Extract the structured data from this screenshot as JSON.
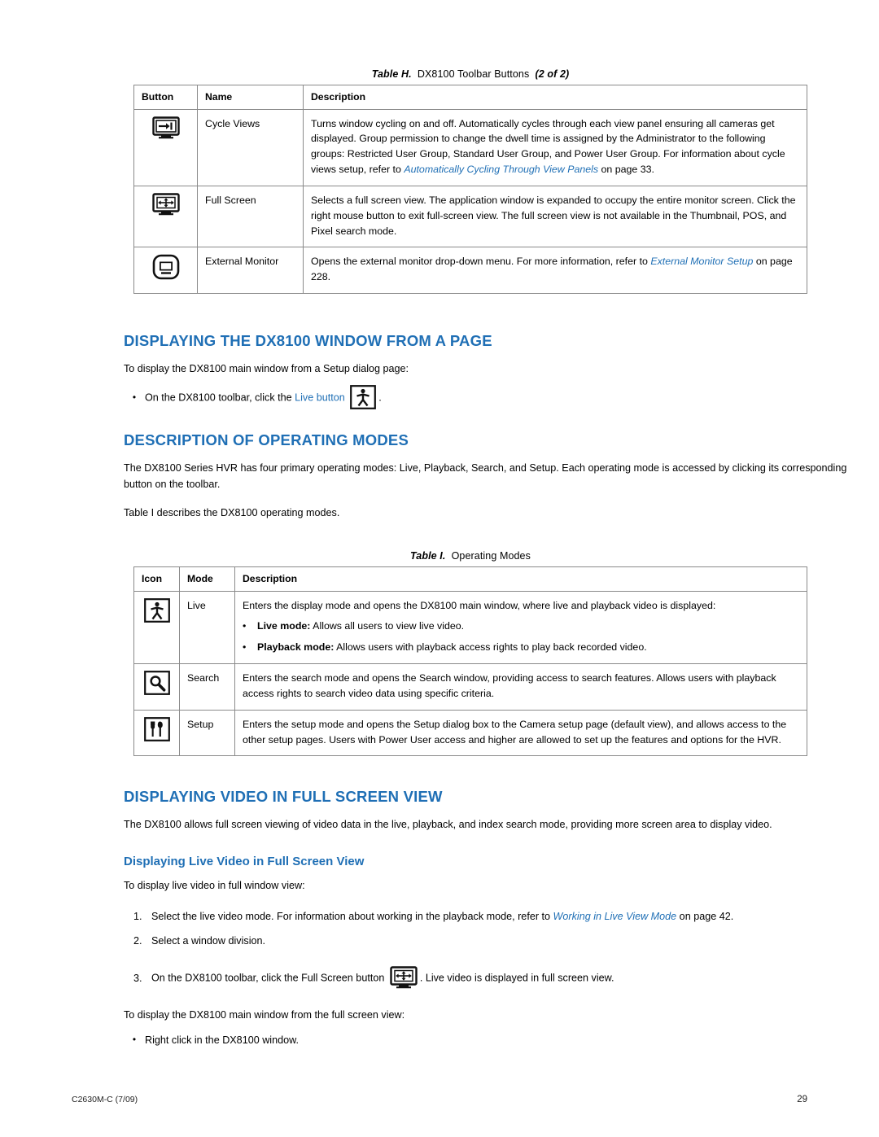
{
  "tableH": {
    "caption_prefix": "Table H.",
    "caption_main": "DX8100 Toolbar Buttons",
    "caption_suffix": "(2 of 2)",
    "headers": [
      "Button",
      "Name",
      "Description"
    ],
    "rows": [
      {
        "icon": "cycle-views-icon",
        "name": "Cycle Views",
        "desc_part1": "Turns window cycling on and off. Automatically cycles through each view panel ensuring all cameras get displayed. Group permission to change the dwell time is assigned by the Administrator to the following groups: Restricted User Group, Standard User Group, and Power User Group. For information about cycle views setup, refer to ",
        "desc_link": "Automatically Cycling Through View Panels",
        "desc_part2": " on page 33."
      },
      {
        "icon": "full-screen-icon",
        "name": "Full Screen",
        "desc_part1": "Selects a full screen view. The application window is expanded to occupy the entire monitor screen. Click the right mouse button to exit full-screen view. The full screen view is not available in the Thumbnail, POS, and Pixel search mode.",
        "desc_link": "",
        "desc_part2": ""
      },
      {
        "icon": "external-monitor-icon",
        "name": "External Monitor",
        "desc_part1": "Opens the external monitor drop-down menu. For more information, refer to ",
        "desc_link": "External Monitor Setup",
        "desc_part2": " on page 228."
      }
    ]
  },
  "section1": {
    "heading": "DISPLAYING THE DX8100 WINDOW FROM A PAGE",
    "intro": "To display the DX8100 main window from a Setup dialog page:",
    "bullet_pre": "On the DX8100 toolbar, click the ",
    "bullet_link": "Live button",
    "bullet_post": "."
  },
  "section2": {
    "heading": "DESCRIPTION OF OPERATING MODES",
    "para1": "The DX8100 Series HVR has four primary operating modes: Live, Playback, Search, and Setup. Each operating mode is accessed by clicking its corresponding button on the toolbar.",
    "para2": "Table I describes the DX8100 operating modes."
  },
  "tableI": {
    "caption_prefix": "Table I.",
    "caption_main": "Operating Modes",
    "headers": [
      "Icon",
      "Mode",
      "Description"
    ],
    "rows": [
      {
        "icon": "live-mode-icon",
        "mode": "Live",
        "desc_intro": "Enters the display mode and opens the DX8100 main window, where live and playback video is displayed:",
        "bullets": [
          {
            "bold": "Live mode:",
            "rest": " Allows all users to view live video."
          },
          {
            "bold": "Playback mode:",
            "rest": " Allows users with playback access rights to play back recorded video."
          }
        ],
        "desc_plain": ""
      },
      {
        "icon": "search-mode-icon",
        "mode": "Search",
        "desc_intro": "",
        "bullets": [],
        "desc_plain": "Enters the search mode and opens the Search window, providing access to search features. Allows users with playback access rights to search video data using specific criteria."
      },
      {
        "icon": "setup-mode-icon",
        "mode": "Setup",
        "desc_intro": "",
        "bullets": [],
        "desc_plain": "Enters the setup mode and opens the Setup dialog box to the Camera setup page (default view), and allows access to the other setup pages. Users with Power User access and higher are allowed to set up the features and options for the HVR."
      }
    ]
  },
  "section3": {
    "heading": "DISPLAYING VIDEO IN FULL SCREEN VIEW",
    "para1": "The DX8100 allows full screen viewing of video data in the live, playback, and index search mode, providing more screen area to display video.",
    "subheading": "Displaying Live Video in Full Screen View",
    "para2": "To display live video in full window view:",
    "steps": [
      {
        "num": "1.",
        "pre": "Select the live video mode. For information about working in the playback mode, refer to ",
        "link": "Working in Live View Mode",
        "post": " on page 42."
      },
      {
        "num": "2.",
        "pre": "Select a window division.",
        "link": "",
        "post": ""
      },
      {
        "num": "3.",
        "pre": "On the DX8100 toolbar, click the Full Screen button",
        "link": "",
        "post": ". Live video is displayed in full screen view."
      }
    ],
    "para3": "To display the DX8100 main window from the full screen view:",
    "bullet": "Right click in the DX8100 window."
  },
  "footer": {
    "doc_id": "C2630M-C (7/09)",
    "page_number": "29"
  }
}
